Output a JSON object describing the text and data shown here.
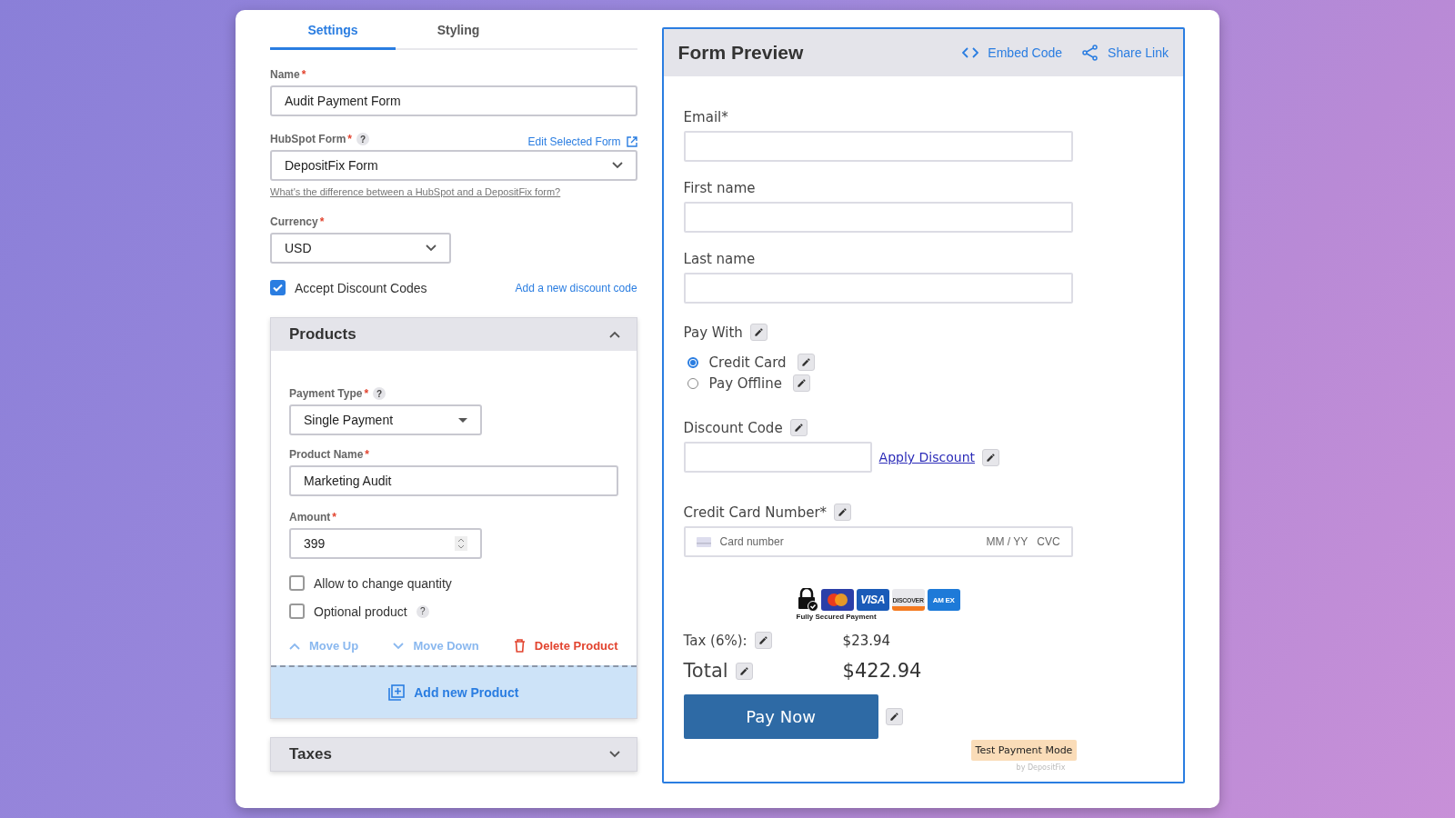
{
  "tabs": [
    {
      "label": "Settings",
      "selected": true
    },
    {
      "label": "Styling",
      "selected": false
    }
  ],
  "settings": {
    "name": {
      "label": "Name",
      "required": "*",
      "value": "Audit Payment Form"
    },
    "hubspot_form": {
      "label": "HubSpot Form",
      "required": "*",
      "help": "?",
      "link": "Edit Selected Form",
      "value": "DepositFix Form",
      "hint_link": "What's the difference between a HubSpot and a DepositFix form?"
    },
    "currency": {
      "label": "Currency",
      "required": "*",
      "value": "USD"
    },
    "discount": {
      "label": "Accept Discount Codes",
      "checked": true,
      "link": "Add a new discount code"
    }
  },
  "products": {
    "title": "Products",
    "expanded": true,
    "payment_type": {
      "label": "Payment Type",
      "required": "*",
      "help": "?",
      "value": "Single Payment"
    },
    "product_name": {
      "label": "Product Name",
      "required": "*",
      "value": "Marketing Audit"
    },
    "amount": {
      "label": "Amount",
      "required": "*",
      "value": "399"
    },
    "options": [
      {
        "label": "Allow to change quantity",
        "checked": false
      },
      {
        "label": "Optional product",
        "checked": false,
        "help": "?"
      }
    ],
    "actions": [
      {
        "kind": "up",
        "label": "Move Up"
      },
      {
        "kind": "down",
        "label": "Move Down"
      },
      {
        "kind": "delete",
        "label": "Delete Product"
      }
    ],
    "add_button": "Add new Product"
  },
  "taxes": {
    "title": "Taxes",
    "expanded": false
  },
  "preview": {
    "title": "Form Preview",
    "actions": [
      {
        "kind": "code",
        "label": "Embed Code"
      },
      {
        "kind": "share",
        "label": "Share Link"
      }
    ],
    "fields": [
      {
        "label": "Email*"
      },
      {
        "label": "First name"
      },
      {
        "label": "Last name"
      }
    ],
    "pay_with": {
      "label": "Pay With",
      "options": [
        {
          "label": "Credit Card",
          "selected": true
        },
        {
          "label": "Pay Offline",
          "selected": false
        }
      ]
    },
    "discount": {
      "label": "Discount Code",
      "link": "Apply Discount"
    },
    "card": {
      "label": "Credit Card Number*",
      "placeholder": "Card number",
      "expiry": "MM / YY",
      "cvc": "CVC"
    },
    "badge": {
      "caption": "Fully Secured Payment",
      "cards": [
        {
          "kind": "mastercard"
        },
        {
          "kind": "visa",
          "label": "VISA"
        },
        {
          "kind": "discover",
          "label": "DISCOVER"
        },
        {
          "kind": "amex",
          "label": "AM EX"
        }
      ]
    },
    "tax": {
      "label": "Tax (6%):",
      "value": "$23.94"
    },
    "total": {
      "label": "Total",
      "value": "$422.94"
    },
    "pay_button": "Pay Now",
    "mode": "Test Payment Mode",
    "credit": "by DepositFix"
  }
}
